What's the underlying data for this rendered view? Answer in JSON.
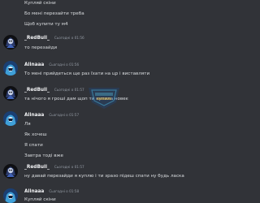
{
  "messages": {
    "top_lines": [
      "Купляй скіни",
      "Бо мені перезайти треба",
      "Щоб купити ту м4"
    ],
    "g1": {
      "author": "_RedBull_",
      "time": "Сьогодні о 01:56",
      "lines": [
        "то перезайди"
      ]
    },
    "g2": {
      "author": "Alinaaa",
      "time": "Сьогодні о 01:56",
      "lines": [
        "То мені прийдеться ще раз їхати на цр і виставляти"
      ]
    },
    "g3": {
      "author": "_RedBull_",
      "time": "Сьогодні о 01:57",
      "lines": [
        "та нічого я гроші дам щоп ти купила новеє"
      ]
    },
    "g4": {
      "author": "Alinaaa",
      "time": "Сьогодні о 01:57",
      "lines": [
        "Ля",
        "Як хочеш",
        "Я спати",
        "Завтра тоді вже"
      ]
    },
    "g5": {
      "author": "_RedBull_",
      "time": "Сьогодні о 01:57",
      "lines": [
        "ну давай перезайди я куплю і ти зразо підеш спати ну будь ласка"
      ]
    },
    "g6": {
      "author": "Alinaaa",
      "time": "Сьогодні о 01:58",
      "lines": [
        "Купляй скіни"
      ]
    }
  },
  "colors": {
    "background": "#313338",
    "text": "#dbdee1",
    "author": "#f2f3f5",
    "timestamp": "#949ba4"
  },
  "icons": {
    "redbull_avatar": "dark-skull-avatar-icon",
    "alina_avatar": "blue-hood-avatar-icon",
    "watermark": "shield-watermark-icon"
  }
}
